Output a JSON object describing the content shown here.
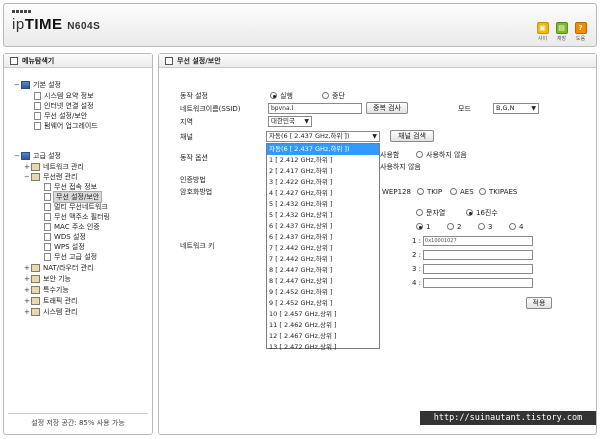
{
  "header": {
    "logo_prefix": "ip",
    "logo_brand": "TIME",
    "model": "N604S",
    "buttons": [
      {
        "label": "사이",
        "icon": "site-icon"
      },
      {
        "label": "재장",
        "icon": "save-icon"
      },
      {
        "label": "도움",
        "icon": "help-icon"
      }
    ]
  },
  "sidebar": {
    "title": "메뉴탐색기",
    "basic": {
      "label": "기본 설정",
      "items": [
        "시스템 요약 정보",
        "인터넷 연결 설정",
        "무선 설정/보안",
        "펌웨어 업그레이드"
      ]
    },
    "advanced": {
      "label": "고급 설정",
      "network": "네트워크 관리",
      "wireless": "무선랜 관리",
      "wireless_items": [
        "무선 접속 정보",
        "무선 설정/보안",
        "멀티 무선네트워크",
        "무선 맥주소 필터링",
        "MAC 주소 인증",
        "WDS 설정",
        "WPS 설정",
        "무선 고급 설정"
      ],
      "others": [
        "NAT/라우터 관리",
        "보안 기능",
        "특수기능",
        "트래픽 관리",
        "시스템 관리"
      ]
    },
    "footer": "설정 저장 공간: 85% 사용 가능"
  },
  "main": {
    "title": "무선 설정/보안",
    "operation_label": "동작 설정",
    "op_run": "실행",
    "op_stop": "중단",
    "ssid_label": "네트워크이름(SSID)",
    "ssid_value": "bpvna.l",
    "dup_check": "중복 검사",
    "mode_label": "모드",
    "mode_value": "B,G,N",
    "region_label": "지역",
    "region_value": "대한민국",
    "channel_label": "채널",
    "channel_value": "자동(6 [ 2.437 GHz,하위 ])",
    "channel_search": "채널 검색",
    "op_options_label": "동작 옵션",
    "opt_use": "사용함",
    "opt_nouse": "사용하지 않음",
    "opt_nouse2": "사용하지 않음",
    "auth_label": "인증방법",
    "enc_label": "암호화방법",
    "enc_options": [
      "WEP128",
      "TKIP",
      "AES",
      "TKIPAES"
    ],
    "key_label": "네트워크 키",
    "key_format_text": "문자열",
    "key_format_hex": "16진수",
    "key_indices": [
      "1",
      "2",
      "3",
      "4"
    ],
    "key_rows": [
      "1 :",
      "2 :",
      "3 :",
      "4 :"
    ],
    "key1_value": "0x10001027",
    "apply": "적용",
    "channel_options": [
      "자동(6 [ 2.437 GHz,하위 ])",
      "1 [ 2.412 GHz,하위 ]",
      "2 [ 2.417 GHz,하위 ]",
      "3 [ 2.422 GHz,하위 ]",
      "4 [ 2.427 GHz,하위 ]",
      "5 [ 2.432 GHz,하위 ]",
      "5 [ 2.432 GHz,상위 ]",
      "6 [ 2.437 GHz,상위 ]",
      "6 [ 2.437 GHz,하위 ]",
      "7 [ 2.442 GHz,상위 ]",
      "7 [ 2.442 GHz,하위 ]",
      "8 [ 2.447 GHz,하위 ]",
      "8 [ 2.447 GHz,상위 ]",
      "9 [ 2.452 GHz,하위 ]",
      "9 [ 2.452 GHz,상위 ]",
      "10 [ 2.457 GHz,상위 ]",
      "11 [ 2.462 GHz,상위 ]",
      "12 [ 2.467 GHz,상위 ]",
      "13 [ 2.472 GHz,상위 ]"
    ]
  },
  "watermark": "http://suinautant.tistory.com"
}
